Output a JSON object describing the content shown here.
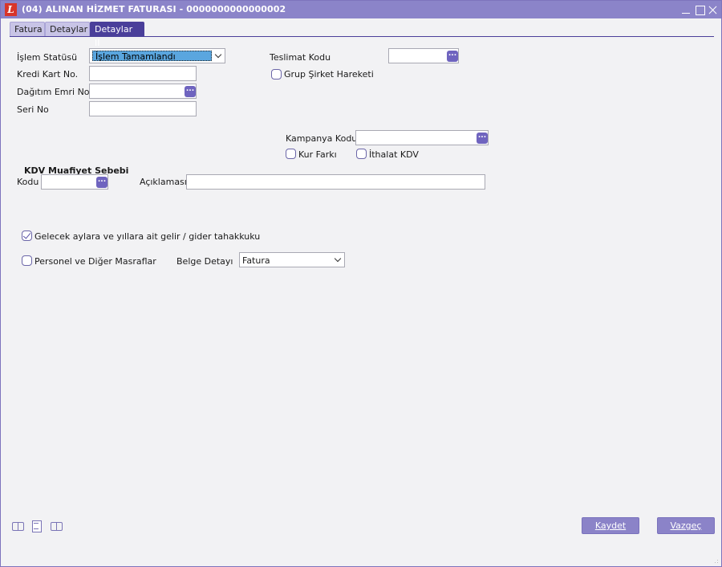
{
  "window": {
    "title": "(04) ALINAN HİZMET FATURASI - 0000000000000002",
    "logo_letter": "L"
  },
  "tabs": [
    {
      "label": "Fatura",
      "active": false
    },
    {
      "label": "Detaylar",
      "active": false
    },
    {
      "label": "Detaylar II",
      "active": true
    }
  ],
  "form": {
    "islem_statusu_label": "İşlem Statüsü",
    "islem_statusu_value": "İşlem Tamamlandı",
    "kredi_kart_label": "Kredi Kart No.",
    "kredi_kart_value": "",
    "dagitim_emri_label": "Dağıtım Emri No.",
    "dagitim_emri_value": "",
    "seri_no_label": "Seri No",
    "seri_no_value": "",
    "teslimat_kodu_label": "Teslimat Kodu",
    "teslimat_kodu_value": "",
    "grup_sirket_label": "Grup Şirket Hareketi",
    "grup_sirket_checked": false,
    "kampanya_kodu_label": "Kampanya Kodu",
    "kampanya_kodu_value": "",
    "kur_farki_label": "Kur Farkı",
    "kur_farki_checked": false,
    "ithalat_kdv_label": "İthalat KDV",
    "ithalat_kdv_checked": false
  },
  "kdv": {
    "section_title": "KDV Muafiyet Sebebi",
    "kodu_label": "Kodu",
    "kodu_value": "",
    "aciklamasi_label": "Açıklaması",
    "aciklamasi_value": ""
  },
  "options": {
    "tahakkuk_label": "Gelecek aylara ve yıllara ait gelir / gider tahakkuku",
    "tahakkuk_checked": true,
    "personel_label": "Personel ve Diğer Masraflar",
    "personel_checked": false,
    "belge_detayi_label": "Belge Detayı",
    "belge_detayi_value": "Fatura"
  },
  "lookup_button_glyph": "...",
  "footer": {
    "icons": [
      "book-open-icon",
      "document-icon",
      "book-open-icon"
    ],
    "kaydet_label": "Kaydet",
    "vazgec_label": "Vazgeç"
  },
  "colors": {
    "titlebar": "#8b84c9",
    "active_tab": "#4a3f9a",
    "lookup_button": "#6f64bf",
    "selection": "#5aa6df",
    "app_logo": "#d8352a"
  }
}
